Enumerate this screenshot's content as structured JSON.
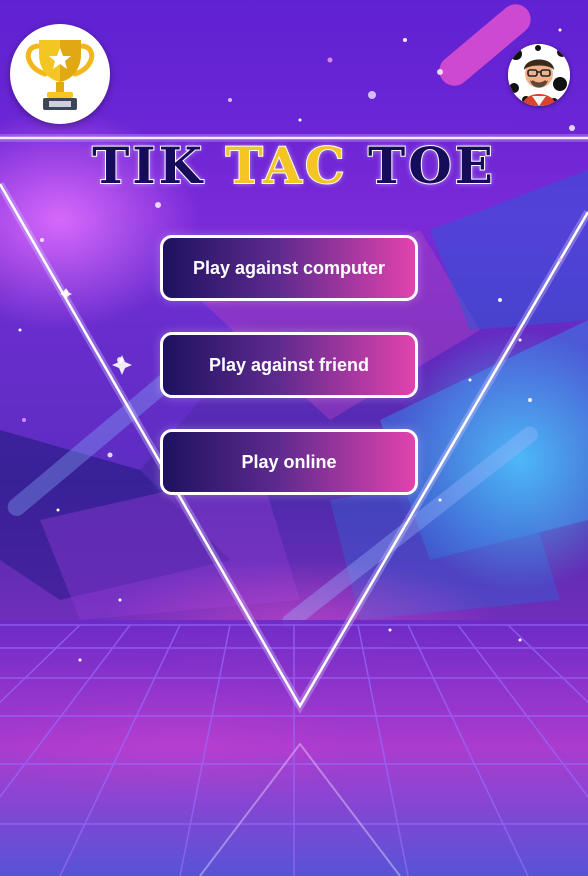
{
  "header": {
    "title_part1": "TIK",
    "title_part2": "TAC",
    "title_part3": "TOE",
    "trophy_icon": "trophy-icon",
    "avatar_icon": "avatar-icon"
  },
  "menu": {
    "buttons": [
      {
        "id": "vs-computer",
        "label": "Play against computer"
      },
      {
        "id": "vs-friend",
        "label": "Play against friend"
      },
      {
        "id": "online",
        "label": "Play online"
      }
    ]
  },
  "colors": {
    "title_dark": "#160c5a",
    "title_accent": "#f3c623",
    "button_start": "#1e1260",
    "button_end": "#e242ae",
    "trophy_gold": "#f3b719"
  }
}
